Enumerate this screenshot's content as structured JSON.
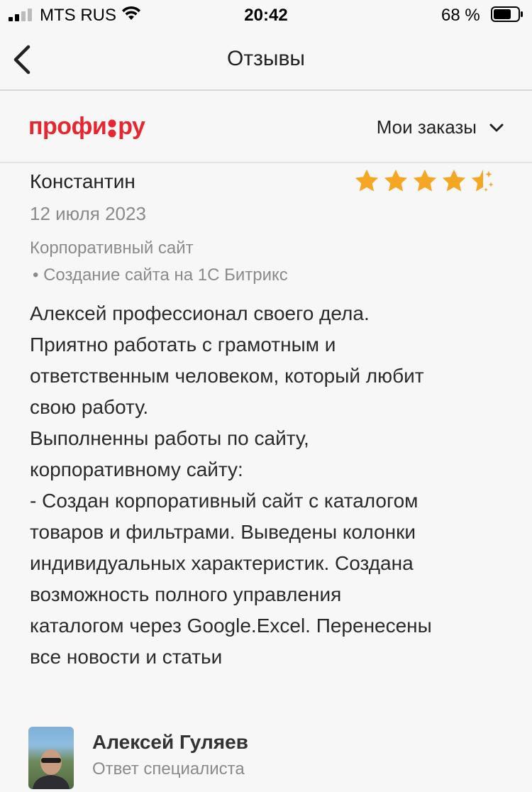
{
  "status_bar": {
    "carrier": "MTS RUS",
    "time": "20:42",
    "battery_percent": "68 %",
    "icons": [
      "signal-icon",
      "wifi-icon",
      "battery-icon"
    ]
  },
  "nav": {
    "title": "Отзывы",
    "back_icon": "chevron-left-icon"
  },
  "brand": {
    "logo_text": "профи.ру",
    "orders_label": "Мои заказы",
    "accent_color": "#e8262f"
  },
  "review": {
    "author": "Константин",
    "rating": 4.5,
    "rating_max": 5,
    "star_color": "#f5a623",
    "date": "12 июля 2023",
    "category": "Корпоративный сайт",
    "subcategory": "• Создание сайта на 1С Битрикс",
    "text": "Алексей профессионал своего дела.\nПриятно работать с грамотным и\nответственным человеком, который любит\nсвою работу.\nВыполненны работы по сайту,\nкорпоративному сайту:\n- Создан корпоративный сайт с каталогом\nтоваров и фильтрами. Выведены колонки\nиндивидуальных характеристик. Создана\nвозможность полного управления\nкаталогом через Google.Excel. Перенесены\nвсе новости и статьи"
  },
  "answer": {
    "name": "Алексей Гуляев",
    "role": "Ответ специалиста"
  }
}
